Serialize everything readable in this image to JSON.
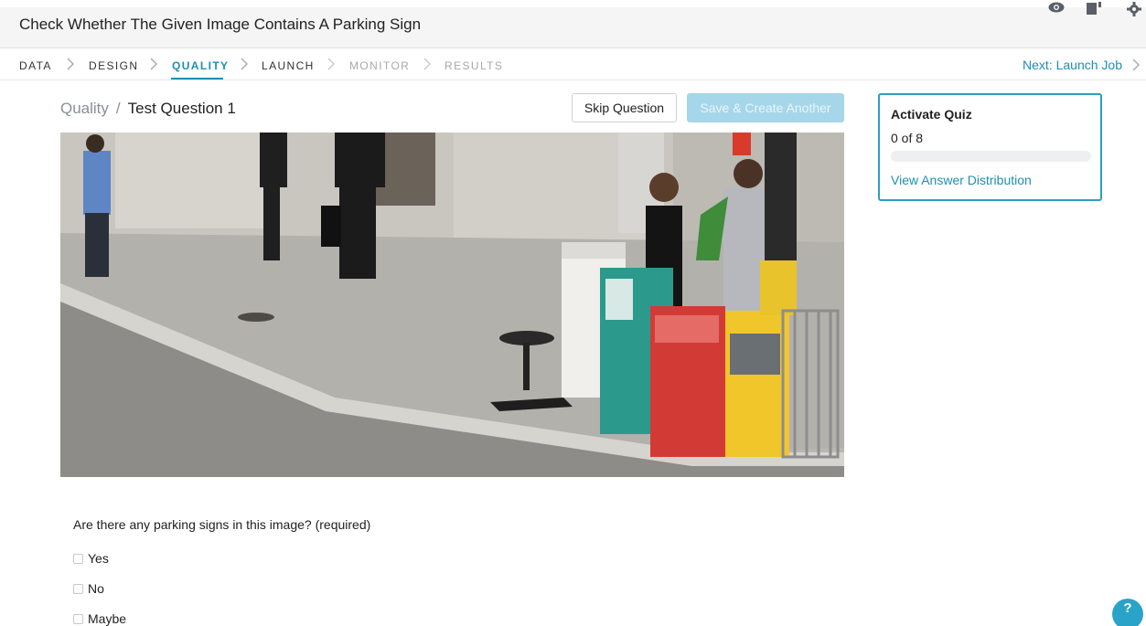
{
  "header": {
    "job_title": "Check Whether The Given Image Contains A Parking Sign",
    "icons": [
      "eye-icon",
      "book-icon",
      "gear-icon"
    ]
  },
  "steps": {
    "items": [
      {
        "label": "DATA",
        "state": "done"
      },
      {
        "label": "DESIGN",
        "state": "done"
      },
      {
        "label": "QUALITY",
        "state": "active"
      },
      {
        "label": "LAUNCH",
        "state": "done"
      },
      {
        "label": "MONITOR",
        "state": "disabled"
      },
      {
        "label": "RESULTS",
        "state": "disabled"
      }
    ],
    "next_label": "Next: Launch Job"
  },
  "breadcrumb": {
    "root": "Quality",
    "separator": "/",
    "current": "Test Question 1"
  },
  "actions": {
    "skip_label": "Skip Question",
    "save_label": "Save & Create Another"
  },
  "quiz": {
    "title": "Activate Quiz",
    "progress_text": "0 of 8",
    "progress_fraction": 0,
    "link_label": "View Answer Distribution"
  },
  "question": {
    "prompt": "Are there any parking signs in this image?",
    "required_label": "(required)",
    "options": [
      "Yes",
      "No",
      "Maybe"
    ]
  },
  "help": {
    "label": "?"
  },
  "colors": {
    "accent": "#1d8fb5",
    "save_button_disabled": "#a6d6ea",
    "quiz_border": "#2a9fbf"
  }
}
